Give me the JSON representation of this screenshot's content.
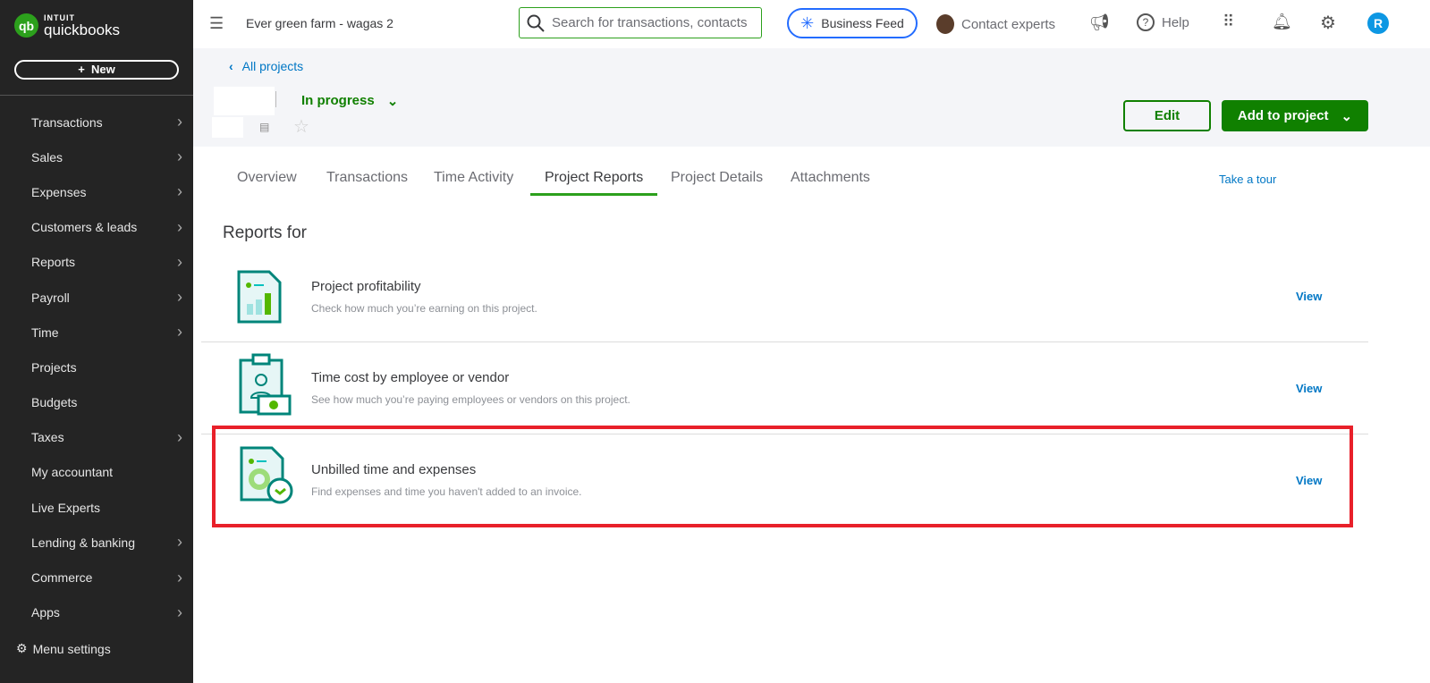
{
  "sidebar": {
    "logo_top": "INTUIT",
    "logo_bottom": "quickbooks",
    "new_label": "New",
    "items": [
      {
        "label": "Transactions",
        "chevron": true
      },
      {
        "label": "Sales",
        "chevron": true
      },
      {
        "label": "Expenses",
        "chevron": true
      },
      {
        "label": "Customers & leads",
        "chevron": true
      },
      {
        "label": "Reports",
        "chevron": true
      },
      {
        "label": "Payroll",
        "chevron": true
      },
      {
        "label": "Time",
        "chevron": true
      },
      {
        "label": "Projects",
        "chevron": false
      },
      {
        "label": "Budgets",
        "chevron": false
      },
      {
        "label": "Taxes",
        "chevron": true
      },
      {
        "label": "My accountant",
        "chevron": false
      },
      {
        "label": "Live Experts",
        "chevron": false
      },
      {
        "label": "Lending & banking",
        "chevron": true
      },
      {
        "label": "Commerce",
        "chevron": true
      },
      {
        "label": "Apps",
        "chevron": true
      }
    ],
    "menu_settings": "Menu settings"
  },
  "topbar": {
    "company": "Ever green farm - wagas 2",
    "search_placeholder": "Search for transactions, contacts",
    "business_feed": "Business Feed",
    "contact_experts": "Contact experts",
    "help": "Help",
    "avatar_initial": "R"
  },
  "project": {
    "back_link": "All projects",
    "status": "In progress",
    "edit": "Edit",
    "add_to_project": "Add to project"
  },
  "tabs": [
    "Overview",
    "Transactions",
    "Time Activity",
    "Project Reports",
    "Project Details",
    "Attachments"
  ],
  "take_tour": "Take a tour",
  "reports_heading": "Reports for",
  "reports": [
    {
      "title": "Project profitability",
      "desc": "Check how much you’re earning on this project.",
      "view": "View"
    },
    {
      "title": "Time cost by employee or vendor",
      "desc": "See how much you’re paying employees or vendors on this project.",
      "view": "View"
    },
    {
      "title": "Unbilled time and expenses",
      "desc": "Find expenses and time you haven't added to an invoice.",
      "view": "View"
    }
  ],
  "colors": {
    "brand_green": "#2ca01c",
    "button_green": "#108000",
    "link_blue": "#0077c5",
    "highlight_red": "#e8202a"
  }
}
